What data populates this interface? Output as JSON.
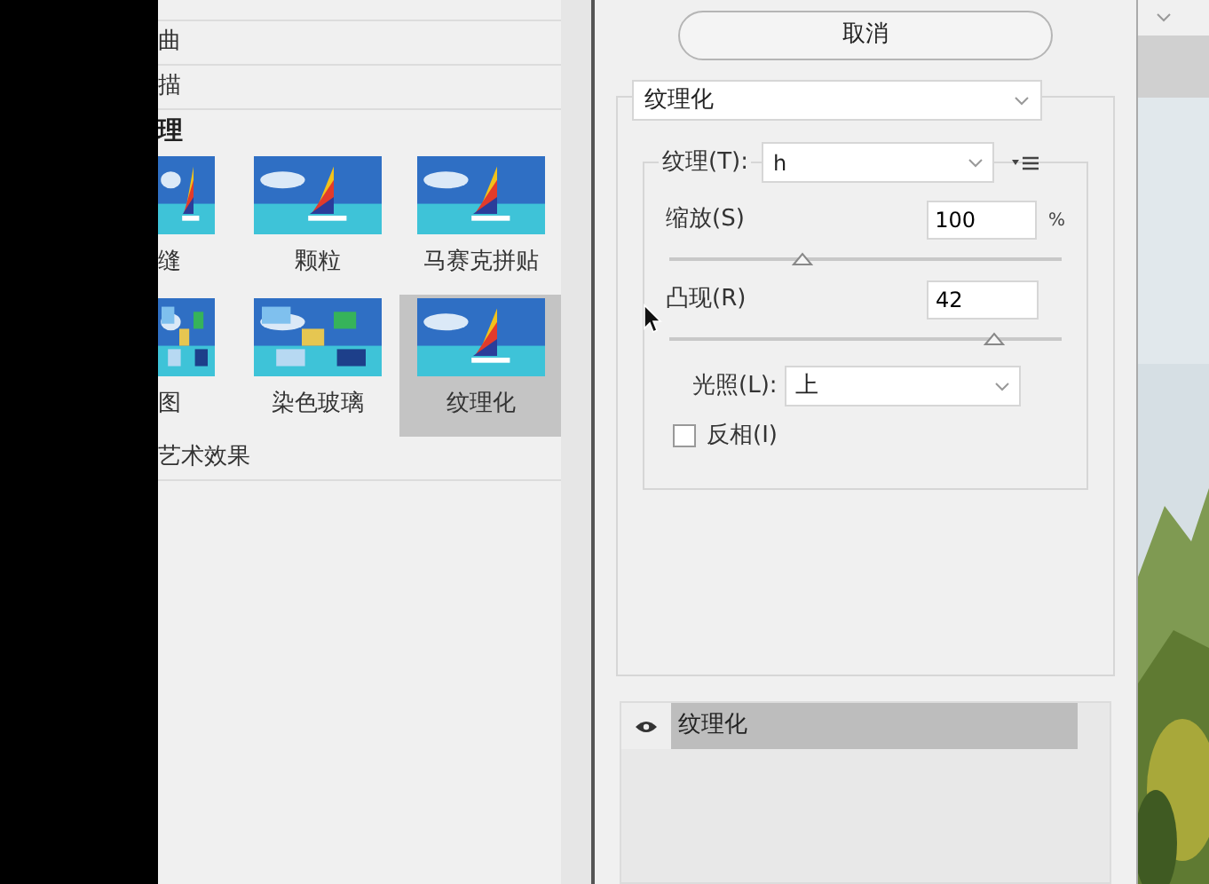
{
  "categories": [
    {
      "label": "曲"
    },
    {
      "label": "描"
    }
  ],
  "open_category": {
    "label": "理",
    "filters": [
      {
        "label": "缝",
        "selected": false
      },
      {
        "label": "颗粒",
        "selected": false
      },
      {
        "label": "马赛克拼贴",
        "selected": false
      },
      {
        "label": "图",
        "selected": false
      },
      {
        "label": "染色玻璃",
        "selected": false
      },
      {
        "label": "纹理化",
        "selected": true
      }
    ]
  },
  "categories_after": [
    {
      "label": "艺术效果"
    }
  ],
  "cancel_button": "取消",
  "filter_select": {
    "value": "纹理化"
  },
  "texture": {
    "label": "纹理(T):",
    "value": "h"
  },
  "scaling": {
    "label": "缩放(S)",
    "value": "100",
    "unit": "%",
    "level": 0.34
  },
  "relief": {
    "label": "凸现(R)",
    "value": "42",
    "level": 0.83
  },
  "light": {
    "label": "光照(L):",
    "value": "上"
  },
  "invert": {
    "label": "反相(I)",
    "checked": false
  },
  "effect_layers": [
    {
      "label": "纹理化",
      "visible": true,
      "selected": true
    }
  ]
}
